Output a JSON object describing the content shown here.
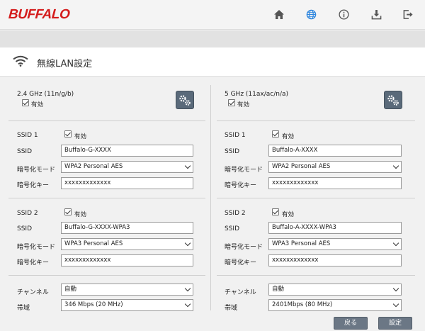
{
  "brand": {
    "logo": "BUFFALO",
    "accent": "#d41c1c"
  },
  "nav": {
    "icons": [
      "home-icon",
      "globe-icon",
      "info-icon",
      "download-icon",
      "logout-icon"
    ],
    "active_color": "#2e86de"
  },
  "page": {
    "title": "無線LAN設定"
  },
  "left": {
    "band_name": "2.4 GHz (11n/g/b)",
    "band_enabled_label": "有効",
    "ssid1": {
      "label": "SSID 1",
      "enabled_label": "有効",
      "ssid_label": "SSID",
      "ssid_value": "Buffalo-G-XXXX",
      "mode_label": "暗号化モード",
      "mode_value": "WPA2 Personal AES",
      "key_label": "暗号化キー",
      "key_value": "xxxxxxxxxxxxx"
    },
    "ssid2": {
      "label": "SSID 2",
      "enabled_label": "有効",
      "ssid_label": "SSID",
      "ssid_value": "Buffalo-G-XXXX-WPA3",
      "mode_label": "暗号化モード",
      "mode_value": "WPA3 Personal AES",
      "key_label": "暗号化キー",
      "key_value": "xxxxxxxxxxxxx"
    },
    "channel_label": "チャンネル",
    "channel_value": "自動",
    "bandwidth_label": "帯域",
    "bandwidth_value": "346 Mbps (20 MHz)"
  },
  "right": {
    "band_name": "5 GHz (11ax/ac/n/a)",
    "band_enabled_label": "有効",
    "ssid1": {
      "label": "SSID 1",
      "enabled_label": "有効",
      "ssid_label": "SSID",
      "ssid_value": "Buffalo-A-XXXX",
      "mode_label": "暗号化モード",
      "mode_value": "WPA2 Personal AES",
      "key_label": "暗号化キー",
      "key_value": "xxxxxxxxxxxxx"
    },
    "ssid2": {
      "label": "SSID 2",
      "enabled_label": "有効",
      "ssid_label": "SSID",
      "ssid_value": "Buffalo-A-XXXX-WPA3",
      "mode_label": "暗号化モード",
      "mode_value": "WPA3 Personal AES",
      "key_label": "暗号化キー",
      "key_value": "xxxxxxxxxxxxx"
    },
    "channel_label": "チャンネル",
    "channel_value": "自動",
    "bandwidth_label": "帯域",
    "bandwidth_value": "2401Mbps (80 MHz)"
  },
  "footer": {
    "back_label": "戻る",
    "apply_label": "設定"
  }
}
